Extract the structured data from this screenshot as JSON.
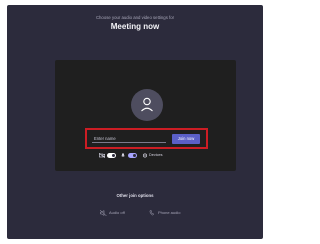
{
  "header": {
    "subtitle": "Choose your audio and video settings for",
    "title": "Meeting now"
  },
  "prejoin": {
    "name_placeholder": "Enter name",
    "join_label": "Join now",
    "controls": {
      "camera": "off",
      "microphone": "on",
      "devices_label": "Devices"
    }
  },
  "other_options": {
    "title": "Other join options",
    "audio_off_label": "Audio off",
    "phone_audio_label": "Phone audio"
  },
  "colors": {
    "background": "#2c2b3c",
    "preview": "#1f1f1f",
    "accent": "#5b5fc7",
    "highlight": "#cc1d24"
  }
}
